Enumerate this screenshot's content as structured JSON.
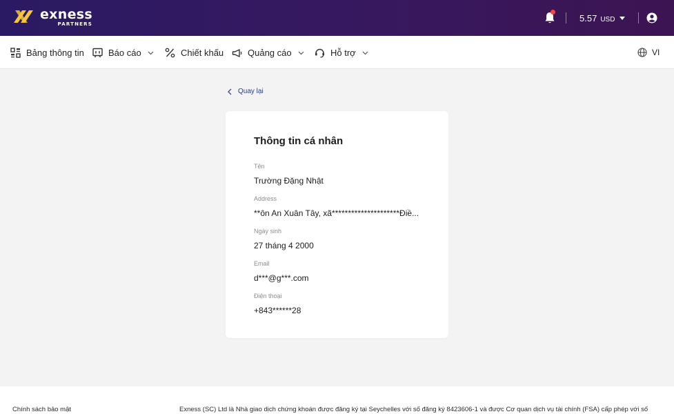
{
  "header": {
    "logo_word": "exness",
    "logo_sub": "PARTNERS",
    "balance_value": "5.57",
    "balance_currency": "USD"
  },
  "nav": {
    "items": [
      {
        "label": "Bảng thông tin",
        "icon": "dashboard-icon"
      },
      {
        "label": "Báo cáo",
        "icon": "report-icon"
      },
      {
        "label": "Chiết khấu",
        "icon": "percent-icon"
      },
      {
        "label": "Quảng cáo",
        "icon": "megaphone-icon"
      },
      {
        "label": "Hỗ trợ",
        "icon": "support-icon"
      }
    ],
    "language": "VI"
  },
  "back_label": "Quay lại",
  "card": {
    "title": "Thông tin cá nhân",
    "fields": [
      {
        "label": "Tên",
        "value": "Trường Đặng Nhật"
      },
      {
        "label": "Address",
        "value": "**ôn An Xuân Tây, xã*********************Điề..."
      },
      {
        "label": "Ngày sinh",
        "value": "27 tháng 4 2000"
      },
      {
        "label": "Email",
        "value": "d***@g***.com"
      },
      {
        "label": "Điện thoại",
        "value": "+843******28"
      }
    ]
  },
  "footer": {
    "privacy_link": "Chính sách bảo mật",
    "legal_text": "Exness (SC) Ltd là Nhà giao dịch chứng khoán được đăng ký tại Seychelles với số đăng ký 8423606-1 và được Cơ quan dịch vụ tài chính (FSA) cấp phép với số"
  },
  "colors": {
    "header_gradient_start": "#2a1a63",
    "header_gradient_end": "#3c1452",
    "logo_accent": "#f4c53a",
    "link": "#2a3c88",
    "notification_dot": "#ef4a4a"
  }
}
